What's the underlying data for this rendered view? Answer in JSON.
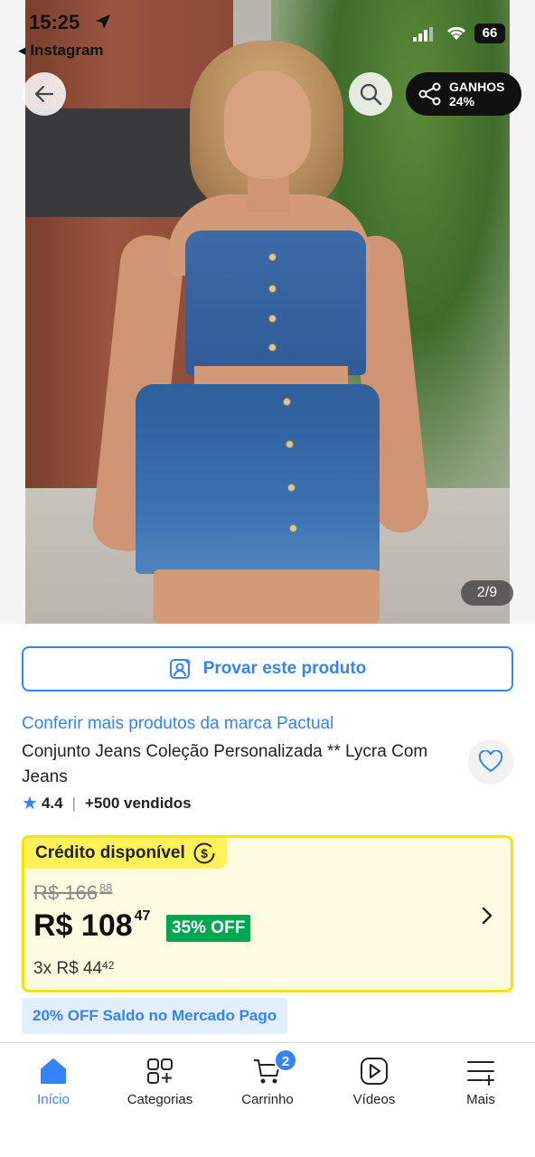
{
  "status_bar": {
    "time": "15:25",
    "back_app": "Instagram",
    "battery": "66"
  },
  "header": {
    "earnings_label": "GANHOS",
    "earnings_value": "24%"
  },
  "gallery": {
    "counter": "2/9"
  },
  "product": {
    "try_button": "Provar este produto",
    "brand_link": "Conferir mais produtos da marca Pactual",
    "title": "Conjunto Jeans Coleção Personalizada ** Lycra Com Jeans",
    "rating": "4.4",
    "separator": "|",
    "sold": "+500 vendidos"
  },
  "credit": {
    "tag": "Crédito disponível",
    "old_price_main": "R$ 166",
    "old_price_cents": "88",
    "price_main": "R$ 108",
    "price_cents": "47",
    "discount": "35% OFF",
    "installments_main": "3x R$ 44",
    "installments_cents": "42"
  },
  "promo": {
    "mercado_pago": "20% OFF Saldo no Mercado Pago"
  },
  "tabbar": {
    "items": [
      {
        "label": "Início",
        "icon": "home-icon",
        "active": true
      },
      {
        "label": "Categorias",
        "icon": "categories-icon"
      },
      {
        "label": "Carrinho",
        "icon": "cart-icon",
        "badge": "2"
      },
      {
        "label": "Vídeos",
        "icon": "video-icon"
      },
      {
        "label": "Mais",
        "icon": "menu-plus-icon"
      }
    ]
  },
  "colors": {
    "accent": "#3483fa",
    "credit_yellow": "#fff159",
    "discount_green": "#00a650"
  }
}
